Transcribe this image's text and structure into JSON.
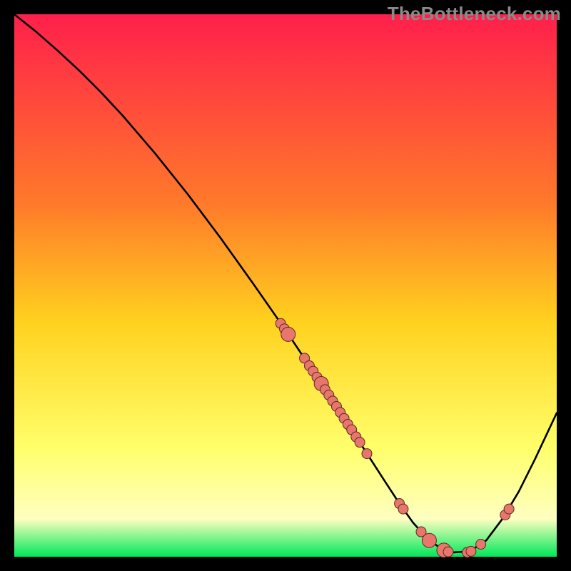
{
  "watermark": "TheBottleneck.com",
  "chart_data": {
    "type": "line",
    "title": "",
    "xlabel": "",
    "ylabel": "",
    "xlim": [
      0,
      100
    ],
    "ylim": [
      0,
      100
    ],
    "grid": false,
    "legend": false,
    "series": [
      {
        "name": "curve",
        "x": [
          0,
          4,
          8,
          12,
          16,
          20,
          26,
          32,
          38,
          44,
          50,
          55,
          60,
          64,
          68,
          71,
          73.5,
          76,
          78.5,
          81,
          84,
          87,
          90,
          93,
          96,
          100
        ],
        "y": [
          100,
          96.8,
          93.3,
          89.6,
          85.6,
          81.3,
          74.3,
          66.8,
          58.8,
          50.4,
          41.8,
          34.3,
          26.8,
          20.6,
          14.4,
          9.8,
          6.3,
          3.5,
          1.6,
          0.8,
          1.0,
          3.0,
          7.0,
          12.0,
          18.0,
          26.5
        ]
      }
    ],
    "markers": [
      {
        "x": 49.1,
        "y": 43.0,
        "r": 7
      },
      {
        "x": 49.8,
        "y": 42.0,
        "r": 7
      },
      {
        "x": 50.5,
        "y": 41.0,
        "r": 10
      },
      {
        "x": 53.5,
        "y": 36.6,
        "r": 7
      },
      {
        "x": 54.4,
        "y": 35.2,
        "r": 7
      },
      {
        "x": 55.1,
        "y": 34.2,
        "r": 7
      },
      {
        "x": 55.8,
        "y": 33.1,
        "r": 7
      },
      {
        "x": 56.6,
        "y": 31.9,
        "r": 10
      },
      {
        "x": 57.3,
        "y": 30.8,
        "r": 7
      },
      {
        "x": 58.0,
        "y": 29.8,
        "r": 7
      },
      {
        "x": 58.7,
        "y": 28.7,
        "r": 7
      },
      {
        "x": 59.4,
        "y": 27.7,
        "r": 7
      },
      {
        "x": 60.1,
        "y": 26.6,
        "r": 7
      },
      {
        "x": 60.8,
        "y": 25.5,
        "r": 7
      },
      {
        "x": 61.5,
        "y": 24.4,
        "r": 7
      },
      {
        "x": 62.2,
        "y": 23.4,
        "r": 7
      },
      {
        "x": 63.0,
        "y": 22.1,
        "r": 7
      },
      {
        "x": 63.7,
        "y": 21.1,
        "r": 7
      },
      {
        "x": 65.0,
        "y": 19.0,
        "r": 7
      },
      {
        "x": 71.0,
        "y": 9.8,
        "r": 7
      },
      {
        "x": 71.7,
        "y": 8.8,
        "r": 7
      },
      {
        "x": 75.0,
        "y": 4.6,
        "r": 7
      },
      {
        "x": 76.5,
        "y": 3.0,
        "r": 10
      },
      {
        "x": 79.2,
        "y": 1.2,
        "r": 10
      },
      {
        "x": 80.0,
        "y": 0.9,
        "r": 7
      },
      {
        "x": 83.5,
        "y": 0.8,
        "r": 7
      },
      {
        "x": 84.2,
        "y": 1.0,
        "r": 7
      },
      {
        "x": 86.0,
        "y": 2.3,
        "r": 7
      },
      {
        "x": 90.5,
        "y": 7.7,
        "r": 7
      },
      {
        "x": 91.2,
        "y": 8.8,
        "r": 7
      }
    ],
    "colors": {
      "gradient_top": "#ff1f4b",
      "gradient_mid1": "#ff7a2a",
      "gradient_mid2": "#ffd21f",
      "gradient_mid3": "#ffff6b",
      "gradient_mid4": "#ffffc0",
      "gradient_bot": "#00e85a",
      "curve": "#000000",
      "marker": "#e8766d",
      "marker_stroke": "#5b2a22"
    }
  }
}
